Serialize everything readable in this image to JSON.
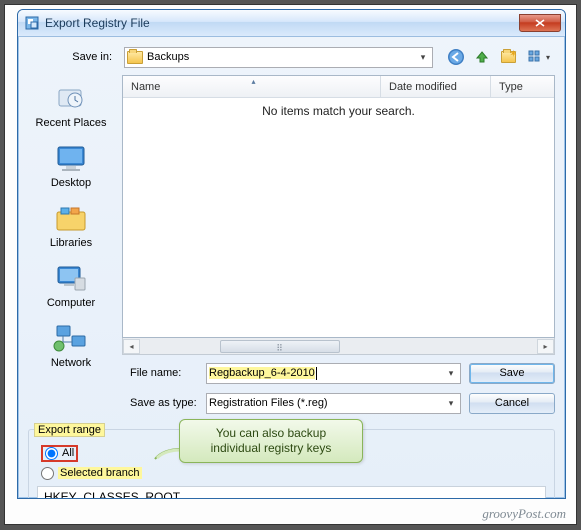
{
  "titlebar": {
    "title": "Export Registry File"
  },
  "savein": {
    "label": "Save in:",
    "folder": "Backups"
  },
  "navicons": {
    "back": "back-icon",
    "up": "up-level-icon",
    "newfolder": "new-folder-icon",
    "viewmenu": "views-menu-icon"
  },
  "sidebar": {
    "items": [
      {
        "label": "Recent Places"
      },
      {
        "label": "Desktop"
      },
      {
        "label": "Libraries"
      },
      {
        "label": "Computer"
      },
      {
        "label": "Network"
      }
    ]
  },
  "listing": {
    "columns": {
      "name": "Name",
      "date": "Date modified",
      "type": "Type"
    },
    "empty": "No items match your search."
  },
  "filename": {
    "label": "File name:",
    "value": "Regbackup_6-4-2010"
  },
  "savetype": {
    "label": "Save as type:",
    "value": "Registration Files (*.reg)"
  },
  "buttons": {
    "save": "Save",
    "cancel": "Cancel"
  },
  "export": {
    "legend": "Export range",
    "all": "All",
    "selected": "Selected branch",
    "branch_value": "HKEY_CLASSES_ROOT"
  },
  "callout": {
    "line1": "You can also backup",
    "line2": "individual registry keys"
  },
  "watermark": "groovyPost.com"
}
